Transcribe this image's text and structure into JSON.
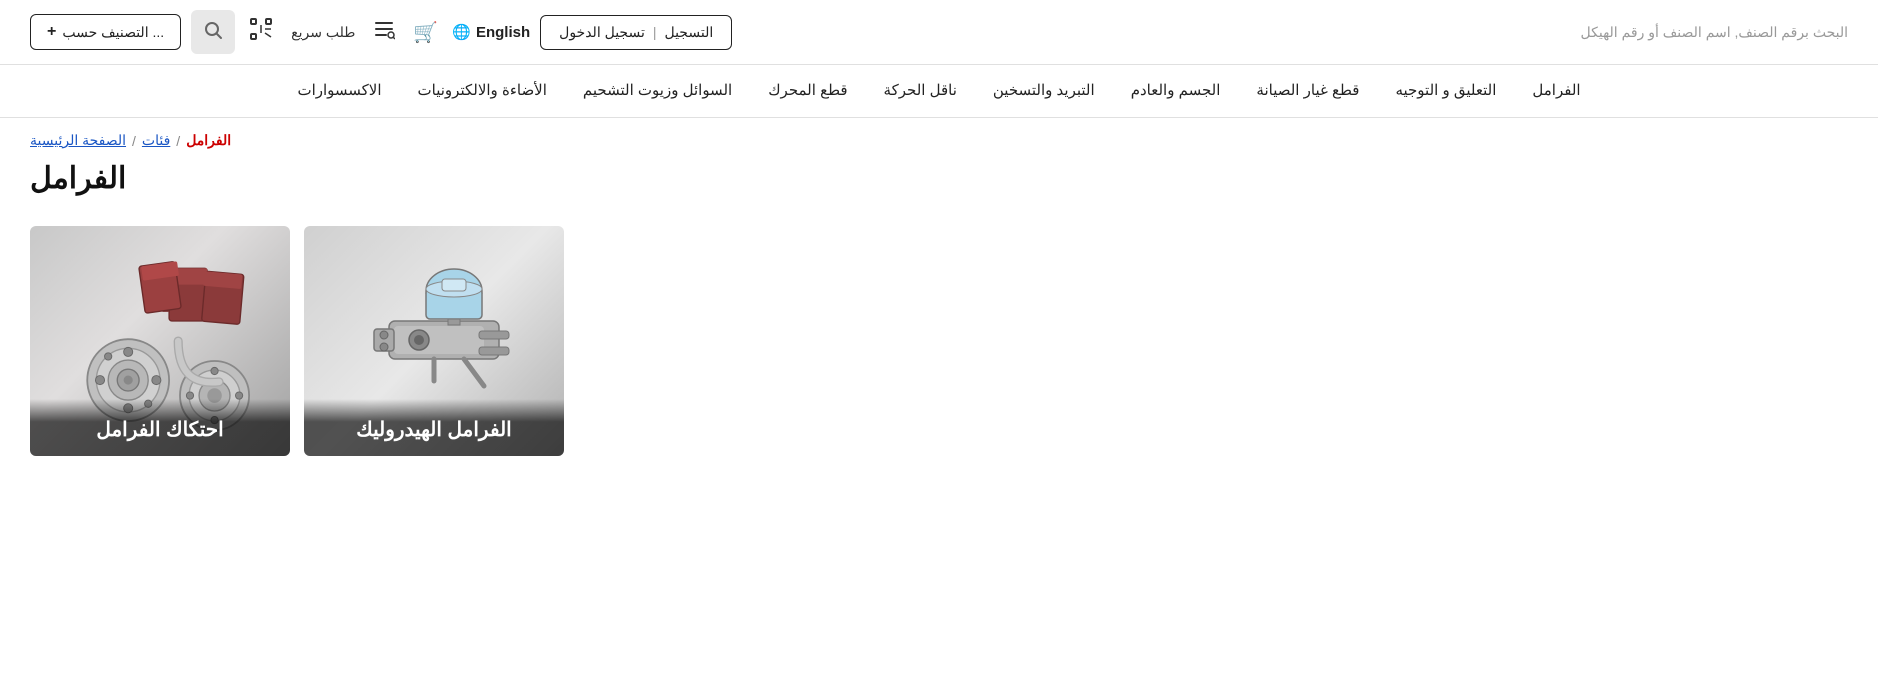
{
  "header": {
    "search_placeholder": "البحث برقم الصنف, اسم الصنف أو رقم الهيكل",
    "classify_label": "... التصنيف حسب",
    "classify_plus": "+",
    "login_label": "التسجيل",
    "register_label": "تسجيل الدخول",
    "lang_label": "English",
    "quick_order_label": "طلب سريع"
  },
  "nav": {
    "items": [
      {
        "id": "accessories",
        "label": "الاكسسوارات"
      },
      {
        "id": "lighting",
        "label": "الأضاءة والالكترونيات"
      },
      {
        "id": "lubricants",
        "label": "السوائل وزيوت التشحيم"
      },
      {
        "id": "engine_parts",
        "label": "قطع المحرك"
      },
      {
        "id": "transmission",
        "label": "ناقل الحركة"
      },
      {
        "id": "cooling",
        "label": "التبريد والتسخين"
      },
      {
        "id": "body",
        "label": "الجسم والعادم"
      },
      {
        "id": "maintenance",
        "label": "قطع غيار الصيانة"
      },
      {
        "id": "steering",
        "label": "التعليق و التوجيه"
      },
      {
        "id": "brakes",
        "label": "الفرامل"
      }
    ]
  },
  "breadcrumb": {
    "home": "الصفحة الرئيسية",
    "categories": "فئات",
    "current": "الفرامل"
  },
  "page": {
    "title": "الفرامل"
  },
  "cards": [
    {
      "id": "friction",
      "label": "احتكاك الفرامل",
      "type": "friction"
    },
    {
      "id": "hydraulic",
      "label": "الفرامل الهيدروليك",
      "type": "hydraulic"
    }
  ],
  "icons": {
    "globe": "🌐",
    "cart": "🛒",
    "scan": "⬜",
    "search": "🔍",
    "list": "☰",
    "plus": "+"
  }
}
